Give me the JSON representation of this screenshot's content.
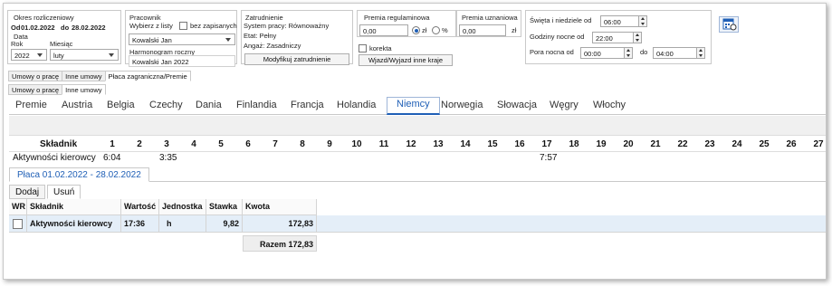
{
  "okres": {
    "title": "Okres rozliczeniowy",
    "od_label": "Od",
    "od_value": "01.02.2022",
    "do_label": "do",
    "do_value": "28.02.2022"
  },
  "data_grp": {
    "title": "Data",
    "rok_label": "Rok",
    "rok_value": "2022",
    "miesiac_label": "Miesiąc",
    "miesiac_value": "luty"
  },
  "pracownik": {
    "title": "Pracownik",
    "wybierz_label": "Wybierz z listy",
    "bez_label": "bez zapisanych",
    "selected": "Kowalski Jan",
    "harmonogram_label": "Harmonogram roczny",
    "harmonogram_value": "Kowalski Jan 2022"
  },
  "zatrudnienie": {
    "title": "Zatrudnienie",
    "system": "System pracy: Równoważny",
    "etat": "Etat: Pełny",
    "angaz": "Angaż: Zasadniczy",
    "modify_button": "Modyfikuj zatrudnienie"
  },
  "premia_reg": {
    "title": "Premia regulaminowa",
    "value": "0,00",
    "zl_label": "zł",
    "pct_label": "%",
    "korekta_label": "korekta",
    "wyjazd_button": "Wjazd/Wyjazd inne kraje"
  },
  "premia_uzn": {
    "title": "Premia uznaniowa",
    "value": "0,00",
    "zl_label": "zł"
  },
  "godziny": {
    "swieta_label": "Święta i niedziele od",
    "swieta_value": "06:00",
    "nocne_label": "Godziny nocne od",
    "nocne_value": "22:00",
    "pora_label": "Pora nocna od",
    "pora_od": "00:00",
    "pora_do_label": "do",
    "pora_do": "04:00"
  },
  "subtabs_row1": [
    "Umowy o pracę",
    "Inne umowy",
    "Płaca zagraniczna/Premie"
  ],
  "subtabs_row2": [
    "Umowy o pracę",
    "Inne umowy"
  ],
  "country_tabs": [
    "Premie",
    "Austria",
    "Belgia",
    "Czechy",
    "Dania",
    "Finlandia",
    "Francja",
    "Holandia",
    "Niemcy",
    "Norwegia",
    "Słowacja",
    "Węgry",
    "Włochy"
  ],
  "active_country": "Niemcy",
  "grid": {
    "header_label": "Składnik",
    "days": [
      "1",
      "2",
      "3",
      "4",
      "5",
      "6",
      "7",
      "8",
      "9",
      "10",
      "11",
      "12",
      "13",
      "14",
      "15",
      "16",
      "17",
      "18",
      "19",
      "20",
      "21",
      "22",
      "23",
      "24",
      "25",
      "26",
      "27"
    ],
    "row_label": "Aktywności kierowcy",
    "row_values": [
      {
        "day": "1",
        "value": "6:04"
      },
      {
        "day": "3",
        "value": "3:35"
      },
      {
        "day": "17",
        "value": "7:57"
      }
    ]
  },
  "placa_tab": "Płaca 01.02.2022 - 28.02.2022",
  "actions": {
    "add": "Dodaj",
    "remove": "Usuń"
  },
  "table": {
    "headers": [
      "WR",
      "Składnik",
      "Wartość",
      "Jednostka",
      "Stawka",
      "Kwota"
    ],
    "rows": [
      {
        "skladnik": "Aktywności kierowcy",
        "wartosc": "17:36",
        "jednostka": "h",
        "stawka": "9,82",
        "kwota": "172,83"
      }
    ],
    "total_label": "Razem 172,83"
  },
  "colors": {
    "accent": "#1f5fb6",
    "row_highlight": "#e4eef8"
  }
}
